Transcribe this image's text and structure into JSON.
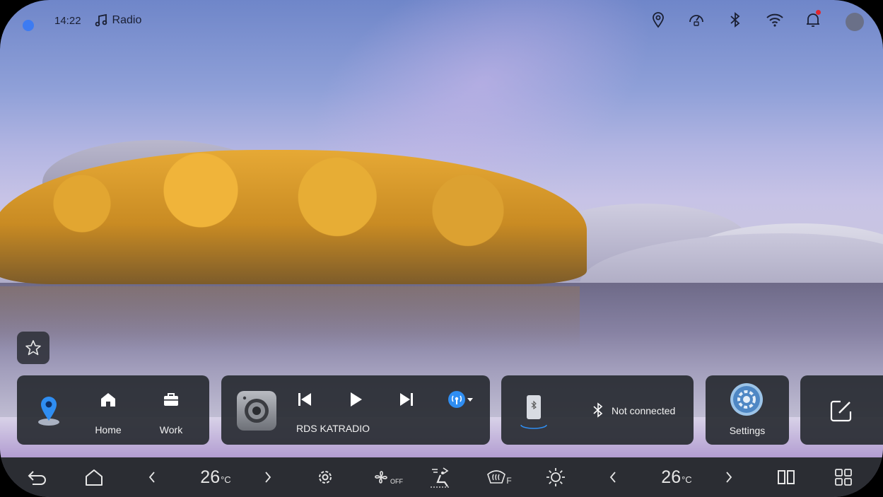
{
  "status_bar": {
    "time": "14:22",
    "app_label": "Radio",
    "icons": [
      "location-icon",
      "speed-limit-icon",
      "bluetooth-icon",
      "wifi-icon",
      "notification-bell-icon"
    ]
  },
  "widgets": {
    "navigation": {
      "home_label": "Home",
      "work_label": "Work"
    },
    "media": {
      "station": "RDS KATRADIO"
    },
    "bluetooth": {
      "status": "Not connected"
    },
    "settings": {
      "label": "Settings"
    }
  },
  "dock": {
    "left_temp": "26",
    "left_temp_unit": "°C",
    "right_temp": "26",
    "right_temp_unit": "°C",
    "fan_state": "OFF",
    "defrost_label": "F"
  },
  "colors": {
    "card_bg": "#282b32",
    "dock_bg": "#2b2d33",
    "accent_blue": "#3d7bf2",
    "notification_red": "#e3262d"
  }
}
